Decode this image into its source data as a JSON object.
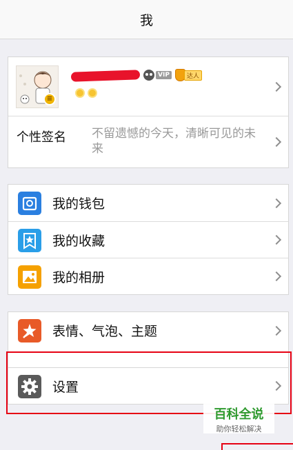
{
  "nav": {
    "title": "我"
  },
  "profile": {
    "vip_label": "VIP",
    "daren_label": "达人",
    "level_badge": "≡"
  },
  "signature": {
    "label": "个性签名",
    "text": "不留遗憾的今天，清晰可见的未来"
  },
  "menu_group_1": [
    {
      "label": "我的钱包",
      "icon": "wallet-icon",
      "color": "#2a7fe0"
    },
    {
      "label": "我的收藏",
      "icon": "favorites-icon",
      "color": "#2a9ee8"
    },
    {
      "label": "我的相册",
      "icon": "album-icon",
      "color": "#f5a100"
    }
  ],
  "menu_group_2": [
    {
      "label": "表情、气泡、主题",
      "icon": "sticker-icon",
      "color": "#e85a28"
    },
    {
      "label": "设置",
      "icon": "gear-icon",
      "color": "#5a5a5a"
    }
  ],
  "watermark": {
    "title": "百科全说",
    "subtitle": "助你轻松解决"
  },
  "colors": {
    "highlight": "#e60012",
    "background": "#efeff4"
  }
}
